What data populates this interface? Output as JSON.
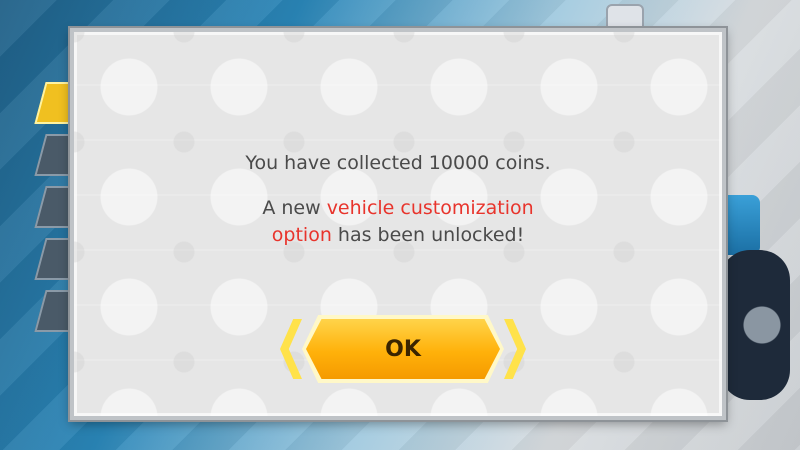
{
  "dialog": {
    "line1": "You have collected 10000 coins.",
    "line2_pre": "A new ",
    "line2_highlight_a": "vehicle customization",
    "line3_highlight_b": "option",
    "line3_post": " has been unlocked!"
  },
  "ok_button": {
    "label": "OK"
  },
  "colors": {
    "highlight": "#e8342c",
    "button": "#ffb10a",
    "dialog_bg": "#e6e6e6"
  },
  "icons": [
    "chevron-left-icon",
    "chevron-right-icon",
    "character-icon",
    "tire-icon"
  ]
}
